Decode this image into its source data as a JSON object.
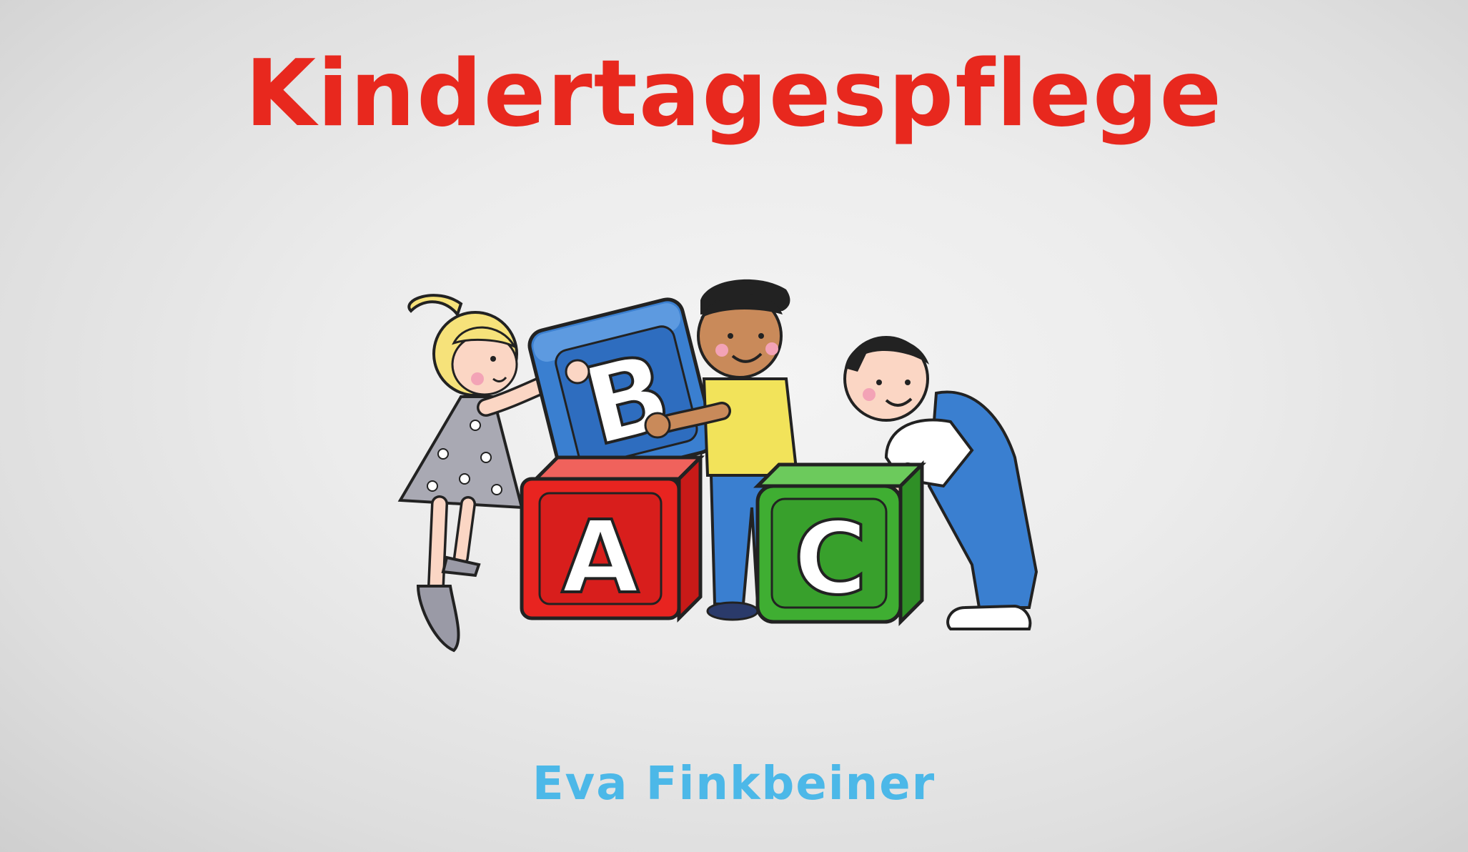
{
  "sign": {
    "title": "Kindertagespflege",
    "name": "Eva Finkbeiner",
    "title_color": "#e8281e",
    "name_color": "#4cb8e8"
  },
  "illustration": {
    "blocks": [
      {
        "letter": "A",
        "color": "#e82420"
      },
      {
        "letter": "B",
        "color": "#3a7fd0"
      },
      {
        "letter": "C",
        "color": "#3fae32"
      }
    ],
    "figures": [
      "girl-grey-dress",
      "boy-yellow-shirt",
      "boy-blue-overalls"
    ]
  }
}
